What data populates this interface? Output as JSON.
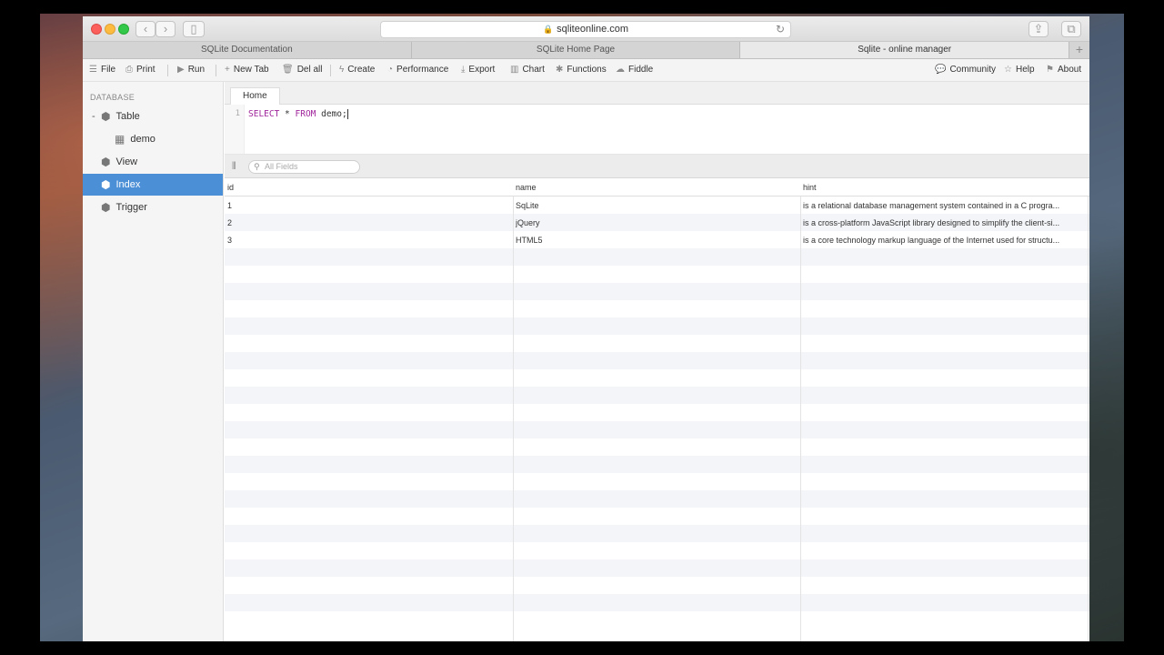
{
  "browser": {
    "url": "sqliteonline.com",
    "tabs": [
      {
        "label": "SQLite Documentation"
      },
      {
        "label": "SQLite Home Page"
      },
      {
        "label": "Sqlite - online manager"
      }
    ]
  },
  "toolbar": {
    "file": "File",
    "print": "Print",
    "run": "Run",
    "new_tab": "New Tab",
    "del_all": "Del all",
    "create": "Create",
    "performance": "Performance",
    "export": "Export",
    "chart": "Chart",
    "functions": "Functions",
    "fiddle": "Fiddle",
    "community": "Community",
    "help": "Help",
    "about": "About"
  },
  "sidebar": {
    "header": "DATABASE",
    "items": [
      {
        "label": "Table",
        "collapse": "-"
      },
      {
        "label": "demo"
      },
      {
        "label": "View"
      },
      {
        "label": "Index"
      },
      {
        "label": "Trigger"
      }
    ]
  },
  "editor": {
    "tab": "Home",
    "line": "1",
    "code_kw1": "SELECT",
    "code_mid": " * ",
    "code_kw2": "FROM",
    "code_rest": " demo;"
  },
  "results": {
    "search_placeholder": "All Fields",
    "columns": [
      "id",
      "name",
      "hint"
    ],
    "rows": [
      {
        "id": "1",
        "name": "SqLite",
        "hint": "is a relational database management system contained in a C progra..."
      },
      {
        "id": "2",
        "name": "jQuery",
        "hint": "is a cross-platform JavaScript library designed to simplify the client-si..."
      },
      {
        "id": "3",
        "name": "HTML5",
        "hint": "is a core technology markup language of the Internet used for structu..."
      }
    ]
  }
}
